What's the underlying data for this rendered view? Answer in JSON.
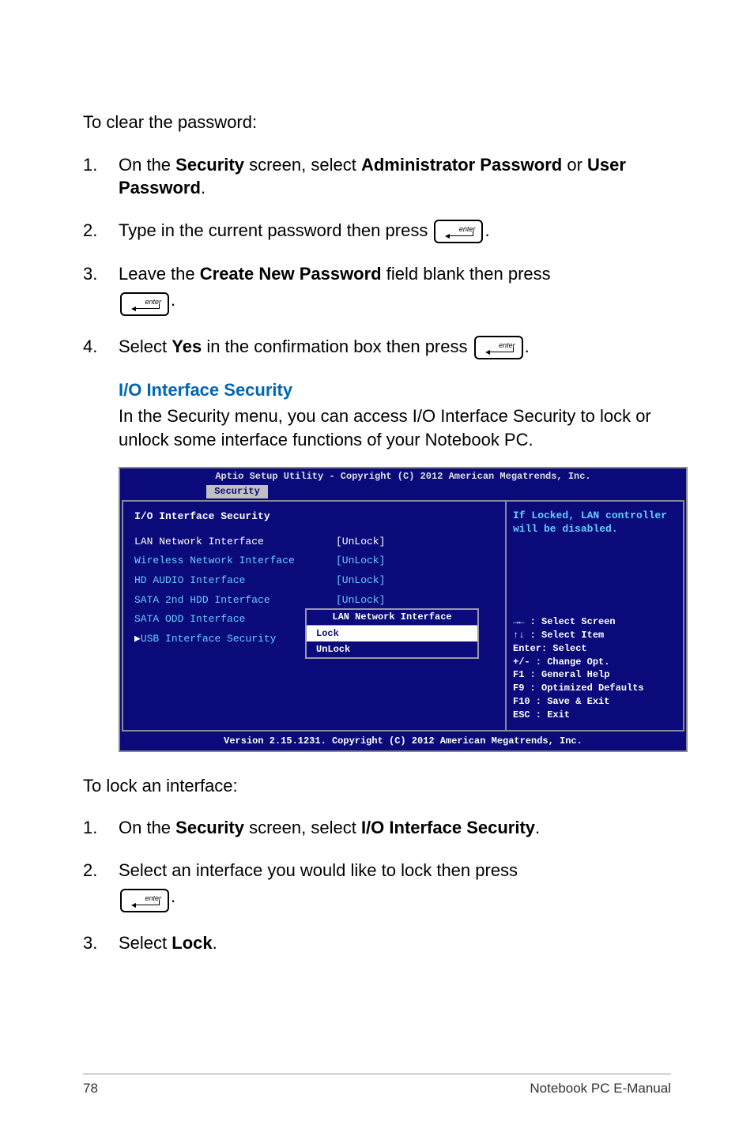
{
  "intro": "To clear the password:",
  "steps1": {
    "s1_pre": "On the ",
    "s1_b1": "Security",
    "s1_mid": " screen, select ",
    "s1_b2": "Administrator Password",
    "s1_or": " or ",
    "s1_b3": "User Password",
    "s1_end": ".",
    "s2": "Type in the current password then press ",
    "s3_pre": "Leave the ",
    "s3_b": "Create New Password",
    "s3_post": " field blank then press ",
    "s4_pre": "Select ",
    "s4_b": "Yes",
    "s4_post": " in the confirmation box then press "
  },
  "section": {
    "title": "I/O Interface Security",
    "desc": "In the Security menu, you can access I/O Interface Security to lock or unlock some interface functions of your Notebook PC."
  },
  "bios": {
    "header": "Aptio Setup Utility - Copyright (C) 2012 American Megatrends, Inc.",
    "tab": "Security",
    "panel_title": "I/O Interface Security",
    "rows": [
      {
        "label": "LAN Network Interface",
        "val": "[UnLock]",
        "hl": true
      },
      {
        "label": "Wireless Network Interface",
        "val": "[UnLock]"
      },
      {
        "label": "HD AUDIO Interface",
        "val": "[UnLock]"
      },
      {
        "label": "SATA 2nd HDD Interface",
        "val": "[UnLock]"
      },
      {
        "label": "SATA ODD Interface",
        "val": ""
      },
      {
        "label": "USB Interface Security",
        "val": "",
        "arrow": true
      }
    ],
    "popup_title": "LAN Network Interface",
    "popup_opts": [
      "Lock",
      "UnLock"
    ],
    "hint": "If Locked, LAN controller will be disabled.",
    "keys": [
      "→←  : Select Screen",
      "↑↓   : Select Item",
      "Enter: Select",
      "+/-  : Change Opt.",
      "F1   : General Help",
      "F9   : Optimized Defaults",
      "F10  : Save & Exit",
      "ESC  : Exit"
    ],
    "footer": "Version 2.15.1231. Copyright (C) 2012 American Megatrends, Inc."
  },
  "intro2": "To lock an interface:",
  "steps2": {
    "s1_pre": "On the ",
    "s1_b1": "Security",
    "s1_mid": " screen, select ",
    "s1_b2": "I/O Interface Security",
    "s1_end": ".",
    "s2": "Select an interface you would like to lock then press ",
    "s3_pre": "Select ",
    "s3_b": "Lock",
    "s3_end": "."
  },
  "footer": {
    "page": "78",
    "title": "Notebook PC E-Manual"
  },
  "period": "."
}
